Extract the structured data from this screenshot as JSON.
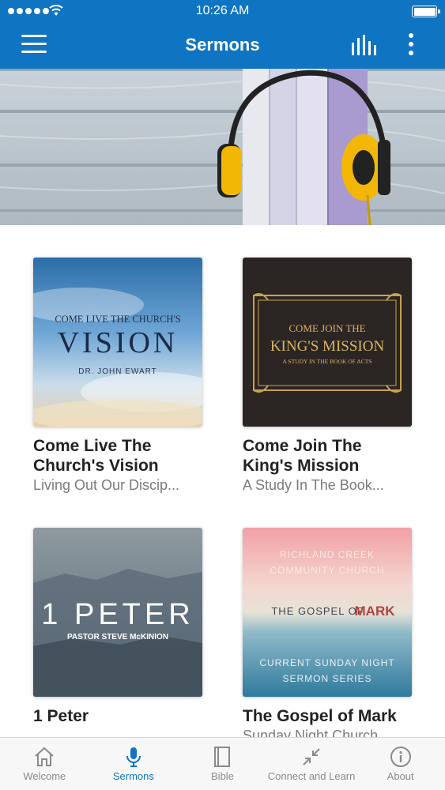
{
  "status_bar": {
    "time": "10:26 AM"
  },
  "header": {
    "title": "Sermons"
  },
  "colors": {
    "brand": "#0f74c1",
    "tab_inactive": "#8a8a8a"
  },
  "sermons": [
    {
      "title_line1": "Come Live The",
      "title_line2": "Church's Vision",
      "subtitle": "Living Out Our Discip...",
      "art": {
        "line1": "COME LIVE THE CHURCH'S",
        "line2": "VISION",
        "line3": "DR. JOHN EWART"
      }
    },
    {
      "title_line1": "Come Join The",
      "title_line2": "King's Mission",
      "subtitle": "A Study In The Book...",
      "art": {
        "line1": "COME JOIN THE",
        "line2": "KING'S MISSION",
        "line3": "A STUDY IN THE BOOK OF ACTS"
      }
    },
    {
      "title_line1": "1 Peter",
      "title_line2": "",
      "subtitle": "",
      "art": {
        "line1": "1 PETER",
        "line2": "PASTOR STEVE McKINION"
      }
    },
    {
      "title_line1": "The Gospel of Mark",
      "title_line2": "",
      "subtitle": "Sunday Night Church",
      "art": {
        "line1": "RICHLAND CREEK",
        "line2": "COMMUNITY CHURCH",
        "line3": "THE GOSPEL OF",
        "line4": "MARK",
        "line5": "CURRENT SUNDAY NIGHT",
        "line6": "SERMON SERIES"
      }
    }
  ],
  "tabs": [
    {
      "label": "Welcome",
      "icon": "home-icon"
    },
    {
      "label": "Sermons",
      "icon": "microphone-icon",
      "active": true
    },
    {
      "label": "Bible",
      "icon": "book-icon"
    },
    {
      "label": "Connect and Learn",
      "icon": "collapse-arrows-icon"
    },
    {
      "label": "About",
      "icon": "info-icon"
    }
  ]
}
